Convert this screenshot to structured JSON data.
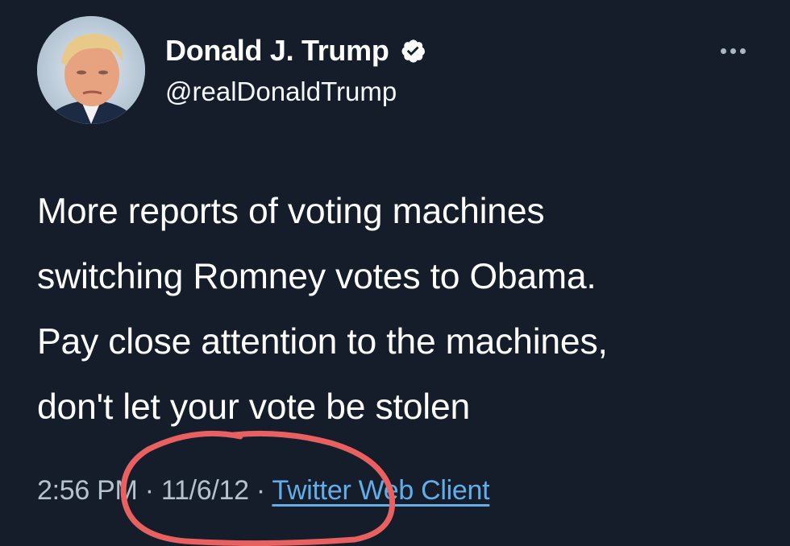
{
  "author": {
    "display_name": "Donald J. Trump",
    "handle": "@realDonaldTrump",
    "verified": true,
    "avatar_icon": "profile-photo"
  },
  "tweet": {
    "text": "More reports of voting machines\nswitching Romney votes to Obama.\nPay close attention to the machines,\ndon't let your vote be stolen",
    "time": "2:56 PM",
    "separator": "·",
    "date": "11/6/12",
    "client": "Twitter Web Client"
  },
  "colors": {
    "background": "#141d29",
    "link": "#63aeea",
    "meta": "#b5c2cd",
    "annotation": "#e8605f"
  },
  "icons": {
    "verified": "verified-badge-icon",
    "more": "more-options-icon"
  }
}
